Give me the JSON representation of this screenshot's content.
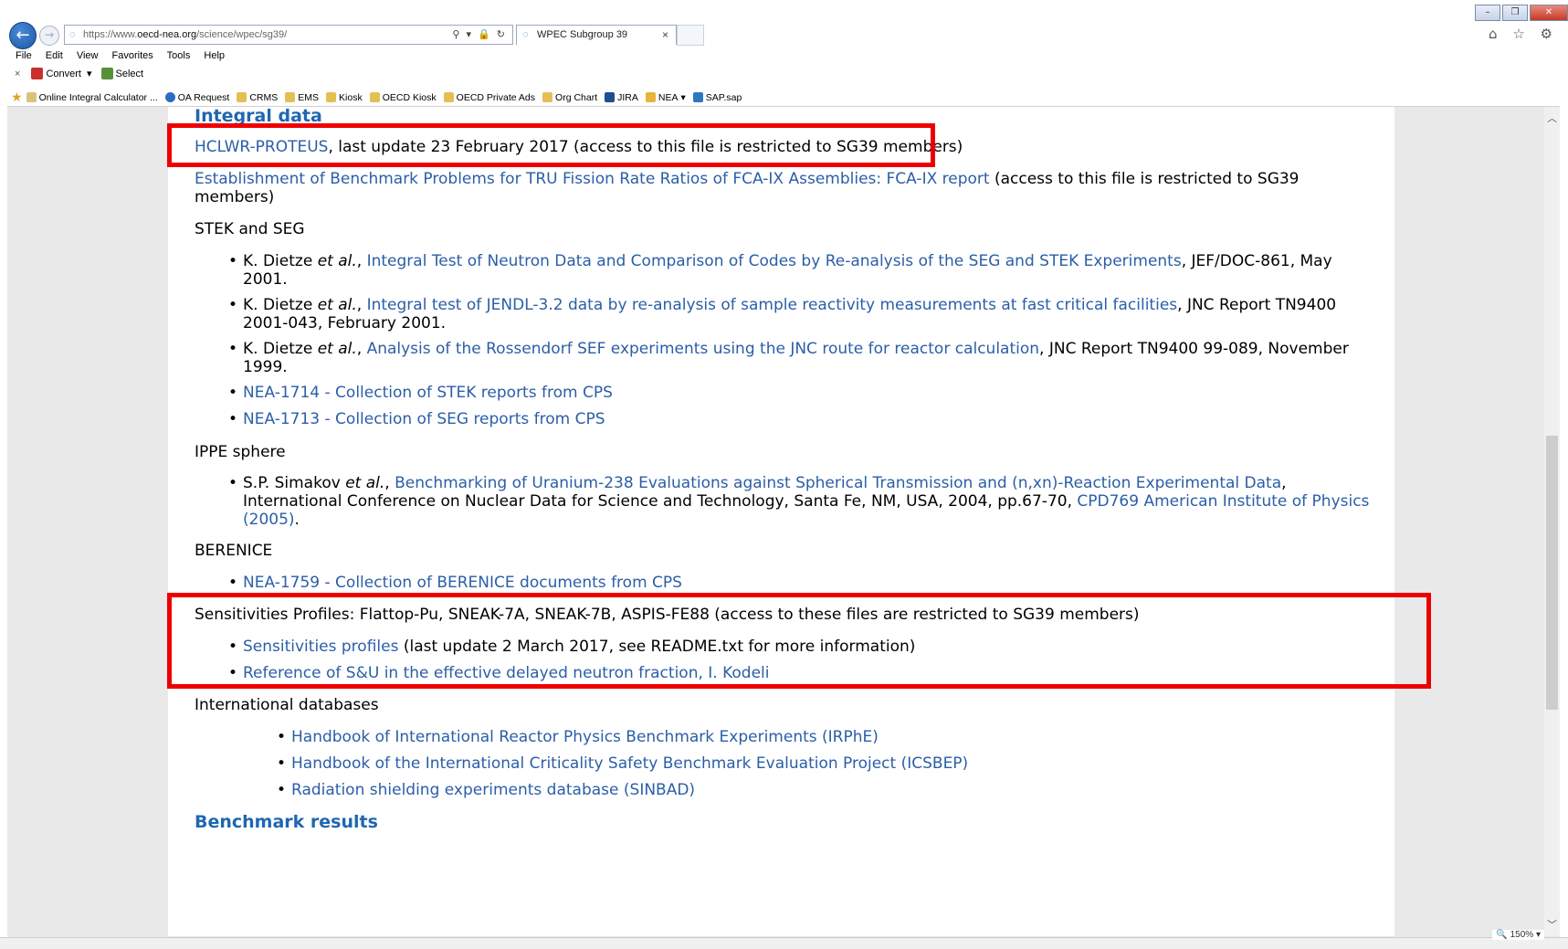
{
  "browser": {
    "url_prefix": "https://www.",
    "url_domain": "oecd-nea.org",
    "url_path": "/science/wpec/sg39/",
    "address_tools": "⚲ ▾ 🔒 ↻",
    "tab_title": "WPEC Subgroup 39",
    "tab_close": "×",
    "window_controls": [
      "–",
      "❐",
      "✕"
    ],
    "right_icons": "⌂ ☆ ⚙",
    "menu": [
      "File",
      "Edit",
      "View",
      "Favorites",
      "Tools",
      "Help"
    ],
    "command_bar": {
      "close": "×",
      "convert": "Convert",
      "select": "Select"
    },
    "favorites": [
      "Online Integral Calculator ...",
      "OA Request",
      "CRMS",
      "EMS",
      "Kiosk",
      "OECD Kiosk",
      "OECD Private Ads",
      "Org Chart",
      "JIRA",
      "NEA",
      "SAP.sap"
    ],
    "zoom": "150%"
  },
  "page": {
    "heading_integral": "Integral data",
    "hclwr_link": "HCLWR-PROTEUS",
    "hclwr_text": ", last update 23 February 2017 (access to this file is restricted to SG39 members)",
    "fca_link": "Establishment of Benchmark Problems for TRU Fission Rate Ratios of FCA-IX Assemblies: FCA-IX report",
    "fca_text": " (access to this file is restricted to SG39 members)",
    "stek_title": "STEK and SEG",
    "stek_items": [
      {
        "pre": "K. Dietze ",
        "em": "et al.",
        "comma": ", ",
        "link": "Integral Test of Neutron Data and Comparison of Codes by Re-analysis of the SEG and STEK Experiments",
        "post": ", JEF/DOC-861, May 2001."
      },
      {
        "pre": "K. Dietze ",
        "em": "et al.",
        "comma": ", ",
        "link": "Integral test of JENDL-3.2 data by re-analysis of sample reactivity measurements at fast critical facilities",
        "post": ", JNC Report TN9400 2001-043, February 2001."
      },
      {
        "pre": "K. Dietze ",
        "em": "et al.",
        "comma": ", ",
        "link": "Analysis of the Rossendorf SEF experiments using the JNC route for reactor calculation",
        "post": ", JNC Report TN9400 99-089, November 1999."
      }
    ],
    "nea1714": "NEA-1714 - Collection of STEK reports from CPS",
    "nea1713": "NEA-1713 - Collection of SEG reports from CPS",
    "ippe_title": "IPPE sphere",
    "ippe_pre": "S.P. Simakov ",
    "ippe_em": "et al.",
    "ippe_comma": ", ",
    "ippe_link": "Benchmarking of Uranium-238 Evaluations against Spherical Transmission and (n,xn)-Reaction Experimental Data",
    "ippe_mid": ", International Conference on Nuclear Data for Science and Technology, Santa Fe, NM, USA, 2004, pp.67-70, ",
    "ippe_link2": "CPD769 American Institute of Physics (2005)",
    "ippe_end": ".",
    "berenice_title": "BERENICE",
    "nea1759": "NEA-1759 - Collection of BERENICE documents from CPS",
    "sens_title": "Sensitivities Profiles: Flattop-Pu, SNEAK-7A, SNEAK-7B, ASPIS-FE88 (access to these files are restricted to SG39 members)",
    "sens_link": "Sensitivities profiles",
    "sens_text": " (last update 2 March 2017, see README.txt for more information)",
    "ref_link": "Reference of S&U in the effective delayed neutron fraction, I. Kodeli",
    "intl_title": "International databases",
    "intl_items": [
      "Handbook of International Reactor Physics Benchmark Experiments (IRPhE)",
      "Handbook of the International Criticality Safety Benchmark Evaluation Project (ICSBEP)",
      "Radiation shielding experiments database (SINBAD)"
    ],
    "heading_bench": "Benchmark results"
  },
  "colors": {
    "link": "#2b5ea7",
    "heading": "#1f67b1",
    "highlight": "#ee0000"
  }
}
